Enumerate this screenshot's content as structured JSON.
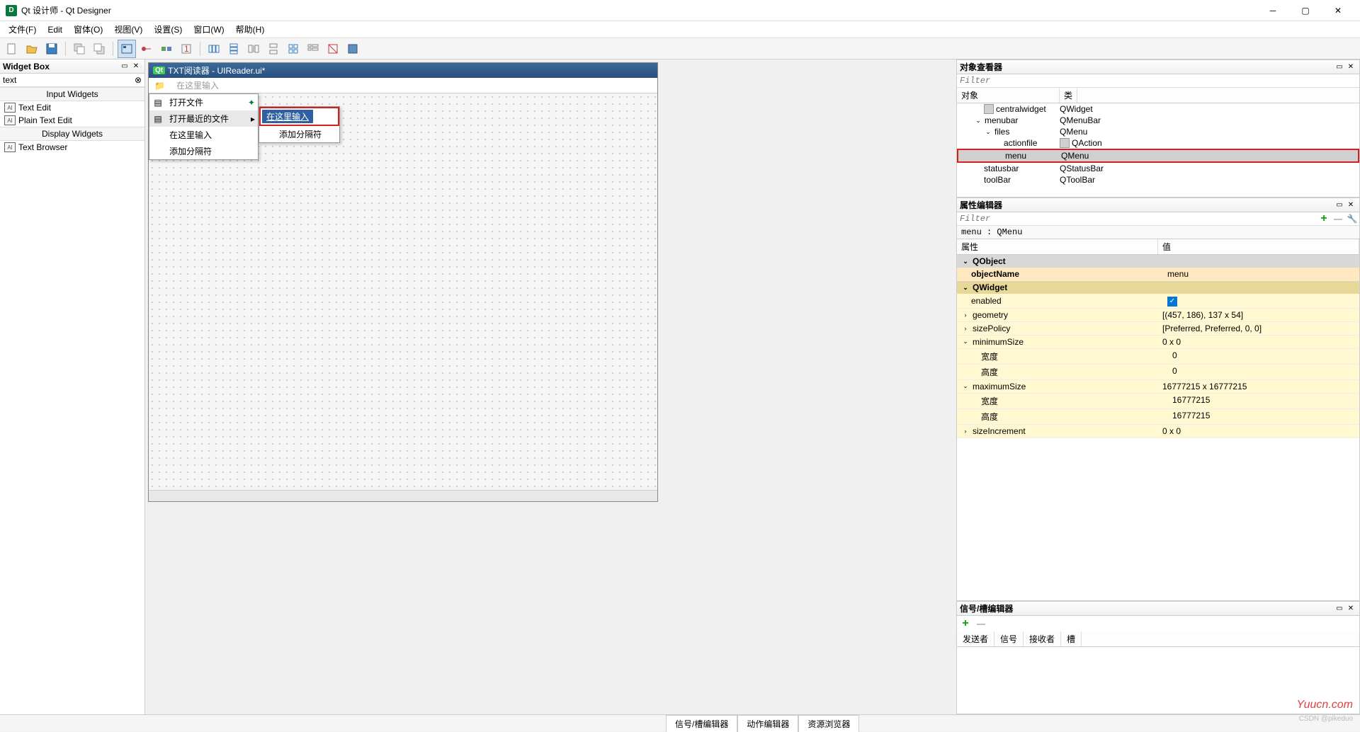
{
  "titlebar": {
    "title": "Qt 设计师 - Qt Designer"
  },
  "menubar": {
    "items": [
      "文件(F)",
      "Edit",
      "窗体(O)",
      "视图(V)",
      "设置(S)",
      "窗口(W)",
      "帮助(H)"
    ]
  },
  "widgetBox": {
    "title": "Widget Box",
    "search": "text",
    "cat1": "Input Widgets",
    "items1": [
      "Text Edit",
      "Plain Text Edit"
    ],
    "cat2": "Display Widgets",
    "items2": [
      "Text Browser"
    ]
  },
  "design": {
    "windowTitle": "TXT阅读器 - UIReader.ui*",
    "menuPlaceholder": "在这里输入",
    "dropdown": {
      "item1": "打开文件",
      "item2": "打开最近的文件",
      "item3": "在这里输入",
      "item4": "添加分隔符"
    },
    "submenu": {
      "item1": "在这里输入",
      "item2": "添加分隔符"
    }
  },
  "objectInspector": {
    "title": "对象查看器",
    "filter": "Filter",
    "colObject": "对象",
    "colClass": "类",
    "rows": [
      {
        "name": "centralwidget",
        "class": "QWidget",
        "indent": 1,
        "icon": "grid"
      },
      {
        "name": "menubar",
        "class": "QMenuBar",
        "indent": 1,
        "expand": "v"
      },
      {
        "name": "files",
        "class": "QMenu",
        "indent": 2,
        "expand": "v"
      },
      {
        "name": "actionfile",
        "class": "QAction",
        "indent": 3,
        "icon": "doc"
      },
      {
        "name": "menu",
        "class": "QMenu",
        "indent": 3,
        "selected": true,
        "highlight": true
      },
      {
        "name": "statusbar",
        "class": "QStatusBar",
        "indent": 1
      },
      {
        "name": "toolBar",
        "class": "QToolBar",
        "indent": 1
      }
    ]
  },
  "propertyEditor": {
    "title": "属性编辑器",
    "filter": "Filter",
    "info": "menu : QMenu",
    "colProp": "属性",
    "colVal": "值",
    "groupQObject": "QObject",
    "groupQWidget": "QWidget",
    "rows": {
      "objectName": {
        "label": "objectName",
        "value": "menu"
      },
      "enabled": {
        "label": "enabled",
        "value": "checked"
      },
      "geometry": {
        "label": "geometry",
        "value": "[(457, 186), 137 x 54]"
      },
      "sizePolicy": {
        "label": "sizePolicy",
        "value": "[Preferred, Preferred, 0, 0]"
      },
      "minimumSize": {
        "label": "minimumSize",
        "value": "0 x 0"
      },
      "minWidth": {
        "label": "宽度",
        "value": "0"
      },
      "minHeight": {
        "label": "高度",
        "value": "0"
      },
      "maximumSize": {
        "label": "maximumSize",
        "value": "16777215 x 16777215"
      },
      "maxWidth": {
        "label": "宽度",
        "value": "16777215"
      },
      "maxHeight": {
        "label": "高度",
        "value": "16777215"
      },
      "sizeIncrement": {
        "label": "sizeIncrement",
        "value": "0 x 0"
      }
    }
  },
  "signalEditor": {
    "title": "信号/槽编辑器",
    "cols": [
      "发送者",
      "信号",
      "接收者",
      "槽"
    ]
  },
  "bottomTabs": [
    "信号/槽编辑器",
    "动作编辑器",
    "资源浏览器"
  ],
  "watermark": "Yuucn.com",
  "watermark2": "CSDN @pikeduo"
}
